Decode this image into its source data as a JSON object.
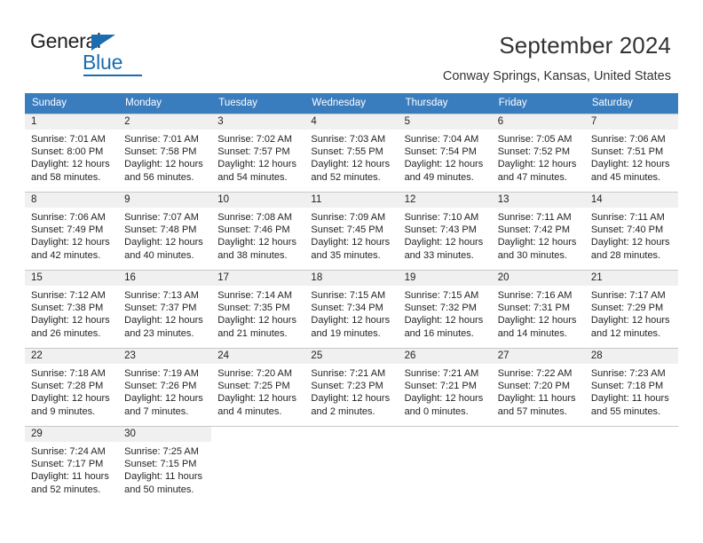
{
  "brand": {
    "name_part1": "General",
    "name_part2": "Blue",
    "triangle_color": "#1b6cb0"
  },
  "header": {
    "title": "September 2024",
    "subtitle": "Conway Springs, Kansas, United States",
    "header_bg": "#3a7dbf",
    "daynum_bg": "#f0f0f0"
  },
  "calendar": {
    "weekday_headers": [
      "Sunday",
      "Monday",
      "Tuesday",
      "Wednesday",
      "Thursday",
      "Friday",
      "Saturday"
    ],
    "labels": {
      "sunrise": "Sunrise:",
      "sunset": "Sunset:",
      "daylight": "Daylight:"
    },
    "weeks": [
      [
        {
          "day": "1",
          "sunrise": "Sunrise: 7:01 AM",
          "sunset": "Sunset: 8:00 PM",
          "daylight1": "Daylight: 12 hours",
          "daylight2": "and 58 minutes."
        },
        {
          "day": "2",
          "sunrise": "Sunrise: 7:01 AM",
          "sunset": "Sunset: 7:58 PM",
          "daylight1": "Daylight: 12 hours",
          "daylight2": "and 56 minutes."
        },
        {
          "day": "3",
          "sunrise": "Sunrise: 7:02 AM",
          "sunset": "Sunset: 7:57 PM",
          "daylight1": "Daylight: 12 hours",
          "daylight2": "and 54 minutes."
        },
        {
          "day": "4",
          "sunrise": "Sunrise: 7:03 AM",
          "sunset": "Sunset: 7:55 PM",
          "daylight1": "Daylight: 12 hours",
          "daylight2": "and 52 minutes."
        },
        {
          "day": "5",
          "sunrise": "Sunrise: 7:04 AM",
          "sunset": "Sunset: 7:54 PM",
          "daylight1": "Daylight: 12 hours",
          "daylight2": "and 49 minutes."
        },
        {
          "day": "6",
          "sunrise": "Sunrise: 7:05 AM",
          "sunset": "Sunset: 7:52 PM",
          "daylight1": "Daylight: 12 hours",
          "daylight2": "and 47 minutes."
        },
        {
          "day": "7",
          "sunrise": "Sunrise: 7:06 AM",
          "sunset": "Sunset: 7:51 PM",
          "daylight1": "Daylight: 12 hours",
          "daylight2": "and 45 minutes."
        }
      ],
      [
        {
          "day": "8",
          "sunrise": "Sunrise: 7:06 AM",
          "sunset": "Sunset: 7:49 PM",
          "daylight1": "Daylight: 12 hours",
          "daylight2": "and 42 minutes."
        },
        {
          "day": "9",
          "sunrise": "Sunrise: 7:07 AM",
          "sunset": "Sunset: 7:48 PM",
          "daylight1": "Daylight: 12 hours",
          "daylight2": "and 40 minutes."
        },
        {
          "day": "10",
          "sunrise": "Sunrise: 7:08 AM",
          "sunset": "Sunset: 7:46 PM",
          "daylight1": "Daylight: 12 hours",
          "daylight2": "and 38 minutes."
        },
        {
          "day": "11",
          "sunrise": "Sunrise: 7:09 AM",
          "sunset": "Sunset: 7:45 PM",
          "daylight1": "Daylight: 12 hours",
          "daylight2": "and 35 minutes."
        },
        {
          "day": "12",
          "sunrise": "Sunrise: 7:10 AM",
          "sunset": "Sunset: 7:43 PM",
          "daylight1": "Daylight: 12 hours",
          "daylight2": "and 33 minutes."
        },
        {
          "day": "13",
          "sunrise": "Sunrise: 7:11 AM",
          "sunset": "Sunset: 7:42 PM",
          "daylight1": "Daylight: 12 hours",
          "daylight2": "and 30 minutes."
        },
        {
          "day": "14",
          "sunrise": "Sunrise: 7:11 AM",
          "sunset": "Sunset: 7:40 PM",
          "daylight1": "Daylight: 12 hours",
          "daylight2": "and 28 minutes."
        }
      ],
      [
        {
          "day": "15",
          "sunrise": "Sunrise: 7:12 AM",
          "sunset": "Sunset: 7:38 PM",
          "daylight1": "Daylight: 12 hours",
          "daylight2": "and 26 minutes."
        },
        {
          "day": "16",
          "sunrise": "Sunrise: 7:13 AM",
          "sunset": "Sunset: 7:37 PM",
          "daylight1": "Daylight: 12 hours",
          "daylight2": "and 23 minutes."
        },
        {
          "day": "17",
          "sunrise": "Sunrise: 7:14 AM",
          "sunset": "Sunset: 7:35 PM",
          "daylight1": "Daylight: 12 hours",
          "daylight2": "and 21 minutes."
        },
        {
          "day": "18",
          "sunrise": "Sunrise: 7:15 AM",
          "sunset": "Sunset: 7:34 PM",
          "daylight1": "Daylight: 12 hours",
          "daylight2": "and 19 minutes."
        },
        {
          "day": "19",
          "sunrise": "Sunrise: 7:15 AM",
          "sunset": "Sunset: 7:32 PM",
          "daylight1": "Daylight: 12 hours",
          "daylight2": "and 16 minutes."
        },
        {
          "day": "20",
          "sunrise": "Sunrise: 7:16 AM",
          "sunset": "Sunset: 7:31 PM",
          "daylight1": "Daylight: 12 hours",
          "daylight2": "and 14 minutes."
        },
        {
          "day": "21",
          "sunrise": "Sunrise: 7:17 AM",
          "sunset": "Sunset: 7:29 PM",
          "daylight1": "Daylight: 12 hours",
          "daylight2": "and 12 minutes."
        }
      ],
      [
        {
          "day": "22",
          "sunrise": "Sunrise: 7:18 AM",
          "sunset": "Sunset: 7:28 PM",
          "daylight1": "Daylight: 12 hours",
          "daylight2": "and 9 minutes."
        },
        {
          "day": "23",
          "sunrise": "Sunrise: 7:19 AM",
          "sunset": "Sunset: 7:26 PM",
          "daylight1": "Daylight: 12 hours",
          "daylight2": "and 7 minutes."
        },
        {
          "day": "24",
          "sunrise": "Sunrise: 7:20 AM",
          "sunset": "Sunset: 7:25 PM",
          "daylight1": "Daylight: 12 hours",
          "daylight2": "and 4 minutes."
        },
        {
          "day": "25",
          "sunrise": "Sunrise: 7:21 AM",
          "sunset": "Sunset: 7:23 PM",
          "daylight1": "Daylight: 12 hours",
          "daylight2": "and 2 minutes."
        },
        {
          "day": "26",
          "sunrise": "Sunrise: 7:21 AM",
          "sunset": "Sunset: 7:21 PM",
          "daylight1": "Daylight: 12 hours",
          "daylight2": "and 0 minutes."
        },
        {
          "day": "27",
          "sunrise": "Sunrise: 7:22 AM",
          "sunset": "Sunset: 7:20 PM",
          "daylight1": "Daylight: 11 hours",
          "daylight2": "and 57 minutes."
        },
        {
          "day": "28",
          "sunrise": "Sunrise: 7:23 AM",
          "sunset": "Sunset: 7:18 PM",
          "daylight1": "Daylight: 11 hours",
          "daylight2": "and 55 minutes."
        }
      ],
      [
        {
          "day": "29",
          "sunrise": "Sunrise: 7:24 AM",
          "sunset": "Sunset: 7:17 PM",
          "daylight1": "Daylight: 11 hours",
          "daylight2": "and 52 minutes."
        },
        {
          "day": "30",
          "sunrise": "Sunrise: 7:25 AM",
          "sunset": "Sunset: 7:15 PM",
          "daylight1": "Daylight: 11 hours",
          "daylight2": "and 50 minutes."
        },
        {
          "day": "",
          "sunrise": "",
          "sunset": "",
          "daylight1": "",
          "daylight2": ""
        },
        {
          "day": "",
          "sunrise": "",
          "sunset": "",
          "daylight1": "",
          "daylight2": ""
        },
        {
          "day": "",
          "sunrise": "",
          "sunset": "",
          "daylight1": "",
          "daylight2": ""
        },
        {
          "day": "",
          "sunrise": "",
          "sunset": "",
          "daylight1": "",
          "daylight2": ""
        },
        {
          "day": "",
          "sunrise": "",
          "sunset": "",
          "daylight1": "",
          "daylight2": ""
        }
      ]
    ]
  }
}
